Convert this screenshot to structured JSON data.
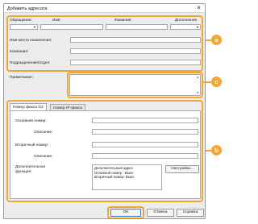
{
  "window": {
    "title": "Добавить адресата",
    "close_glyph": "✕"
  },
  "name_row": {
    "prefix_label": "Обращение:",
    "first_label": "Имя:",
    "last_label": "Фамилия:",
    "suffix_label": "Дополнение"
  },
  "address_fields": {
    "destination_label": "Имя места назначения:",
    "company_label": "Компания:",
    "department_label": "Подразделение/отдел:"
  },
  "notes": {
    "label": "Примечание:"
  },
  "tabs": [
    {
      "label": "Номер факса G3",
      "active": true
    },
    {
      "label": "Номер IP-факса",
      "active": false
    }
  ],
  "fax": {
    "primary_number_label": "Основной номер:",
    "primary_description_label": "Описание:",
    "secondary_number_label": "Вторичный номер:",
    "secondary_description_label": "Описание:",
    "advanced_label_line1": "Дополнительная",
    "advanced_label_line2": "функция:",
    "advanced_lines": [
      "Дополнительный адрес",
      "Основной номер : Выкл",
      "Вторичный номер: Выкл"
    ],
    "settings_button": "Настройки..."
  },
  "buttons": {
    "ok": "OK",
    "cancel": "Отмена",
    "help": "Справка"
  },
  "callouts": {
    "a": "a",
    "b": "b",
    "c": "c"
  },
  "colors": {
    "highlight": "#f0a73a"
  }
}
